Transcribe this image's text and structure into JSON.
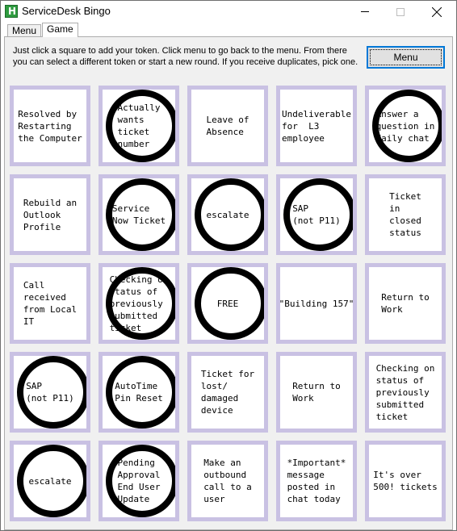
{
  "window": {
    "title": "ServiceDesk Bingo"
  },
  "tabs": [
    {
      "label": "Menu"
    },
    {
      "label": "Game"
    }
  ],
  "instructions": "Just click a square to add your token. Click menu to go back to the menu. From there you can select a different token or start a new round. If you receive duplicates, pick one.",
  "menu_button": "Menu",
  "cells": [
    {
      "text": "Resolved by\nRestarting\nthe Computer",
      "marked": false
    },
    {
      "text": "Actually\nwants\nticket\nnumber",
      "marked": true
    },
    {
      "text": "Leave of\nAbsence",
      "marked": false
    },
    {
      "text": "Undeliverable\nfor  L3\nemployee",
      "marked": false
    },
    {
      "text": "Answer a\nquestion in\ndaily chat",
      "marked": true
    },
    {
      "text": "Rebuild an\nOutlook\nProfile",
      "marked": false
    },
    {
      "text": "Service\nNow Ticket",
      "marked": true
    },
    {
      "text": "escalate",
      "marked": true
    },
    {
      "text": "SAP\n(not P11)",
      "marked": true
    },
    {
      "text": "Ticket\nin\nclosed\nstatus",
      "marked": false
    },
    {
      "text": "Call\nreceived\nfrom Local\nIT",
      "marked": false
    },
    {
      "text": "Checking on\nstatus of\npreviously\nsubmitted\nticket",
      "marked": true
    },
    {
      "text": "FREE",
      "marked": true
    },
    {
      "text": "\"Building 157\"",
      "marked": false
    },
    {
      "text": "Return to\nWork",
      "marked": false
    },
    {
      "text": "SAP\n(not P11)",
      "marked": true
    },
    {
      "text": "AutoTime\nPin Reset",
      "marked": true
    },
    {
      "text": "Ticket for\nlost/\ndamaged\ndevice",
      "marked": false
    },
    {
      "text": "Return to\nWork",
      "marked": false
    },
    {
      "text": "Checking on\nstatus of\npreviously\nsubmitted\nticket",
      "marked": false
    },
    {
      "text": "escalate",
      "marked": true
    },
    {
      "text": "Pending\nApproval\nEnd User\nUpdate",
      "marked": true
    },
    {
      "text": "Make an\noutbound\ncall to a\nuser",
      "marked": false
    },
    {
      "text": "*Important*\nmessage\nposted in\nchat today",
      "marked": false
    },
    {
      "text": "It's over\n500! tickets",
      "marked": false
    }
  ]
}
